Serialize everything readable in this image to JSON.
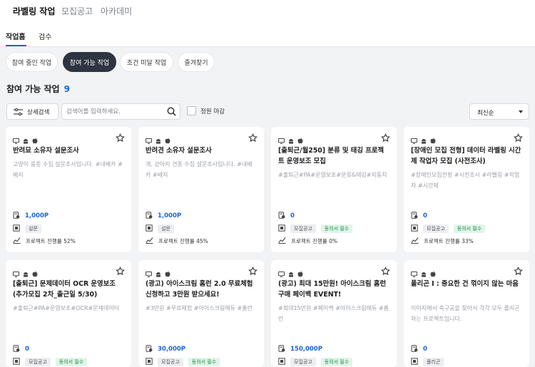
{
  "top_nav": {
    "items": [
      "라벨링 작업",
      "모집공고",
      "아카데미"
    ]
  },
  "sub_nav": {
    "items": [
      "작업홈",
      "검수"
    ]
  },
  "pills": [
    "참여 중인 작업",
    "참여 가능 작업",
    "조건 미달 작업",
    "즐겨찾기"
  ],
  "heading": {
    "label": "참여 가능 작업",
    "count": "9"
  },
  "filter": {
    "label": "상세검색"
  },
  "search": {
    "placeholder": "검색어를 입력하세요."
  },
  "checkbox": {
    "label": "정원 마감"
  },
  "sort": {
    "value": "최신순"
  },
  "progress_prefix": "프로젝트 진행률",
  "cards": [
    {
      "title": "반려묘 소유자 설문조사",
      "desc": "고양이 품종 수집 설문조사입니다. #내배카 #배지",
      "price": "1,000P",
      "tags": [
        "설문"
      ],
      "progress": "52%"
    },
    {
      "title": "반려견 소유자 설문조사",
      "desc": "개, 강아지 견종 수집 설문조사입니다. #내배카 #배지",
      "price": "1,000P",
      "tags": [
        "설문"
      ],
      "progress": "45%"
    },
    {
      "title": "[출퇴근/월250] 분류 및 태깅 프로젝트 운영보조 모집",
      "desc": "#출퇴근#PA#운영보조#분류&태깅#자동차",
      "price": "0",
      "tags": [
        "모집공고",
        "동의서 필수"
      ],
      "progress": "0%"
    },
    {
      "title": "[장애인 모집 전형] 데이터 라벨링 시간제 작업자 모집 (사전조사)",
      "desc": "#장애인모집전형 #사전조사 #라벨링 #작업자 #시간제",
      "price": "0",
      "tags": [
        "모집공고",
        "동의서 필수"
      ],
      "progress": "33%"
    },
    {
      "title": "[출퇴근] 문제데이터 OCR 운영보조 (추가모집 2차_출근일 5/30)",
      "desc": "#출퇴근#PA#운영보조#OCR#문제데이터",
      "price": "0",
      "tags": [
        "모집공고",
        "동의서 필수"
      ]
    },
    {
      "title": "(광고) 아이스크림 홈런 2.0 무료체험 신청하고 3만원 받으세요!",
      "desc": "#3만원 #무료체험 #아이스크림에듀 #홈런",
      "price": "30,000P",
      "tags": [
        "모집공고",
        "동의서 필수"
      ]
    },
    {
      "title": "(광고) 최대 15만원! 아이스크림 홈런 구매 페이백 EVENT!",
      "desc": "#최대15만원 #페이백 #아이스크림에듀 #홈런",
      "price": "150,000P",
      "tags": [
        "모집공고",
        "동의서 필수"
      ]
    },
    {
      "title": "폴리곤 I : 중요한 건 꺾이지 않는 마음",
      "desc": "이미지에서 축구공을 찾아서 각각 모두 폴리곤하는 프로젝트입니다.",
      "price": "0",
      "tags": [
        "폴리곤"
      ]
    }
  ]
}
